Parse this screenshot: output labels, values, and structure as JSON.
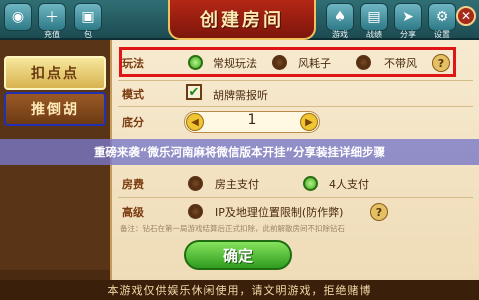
{
  "topbar": {
    "left_icons": [
      {
        "icon": "coin-icon",
        "label": ""
      },
      {
        "icon": "recharge-icon",
        "label": "充值"
      },
      {
        "icon": "gift-icon",
        "label": "包"
      }
    ],
    "right_icons": [
      {
        "icon": "game-icon",
        "label": "游戏"
      },
      {
        "icon": "record-icon",
        "label": "战绩"
      },
      {
        "icon": "share-icon",
        "label": "分享"
      },
      {
        "icon": "settings-icon",
        "label": "设置"
      }
    ],
    "title": "创建房间",
    "close_symbol": "✕"
  },
  "sidebar": {
    "tabs": [
      {
        "label": "扣点点",
        "active": true
      },
      {
        "label": "推倒胡",
        "active": false
      }
    ]
  },
  "form": {
    "play": {
      "label": "玩法",
      "options": [
        {
          "text": "常规玩法",
          "selected": true
        },
        {
          "text": "风耗子",
          "selected": false
        },
        {
          "text": "不带风",
          "selected": false
        }
      ],
      "help": "?"
    },
    "mode": {
      "label": "模式",
      "checkbox_text": "胡牌需报听",
      "checked": true,
      "check_symbol": "✔"
    },
    "score": {
      "label": "底分",
      "value": "1",
      "minus": "◀",
      "plus": "▶"
    },
    "fee": {
      "label": "房费",
      "options": [
        {
          "text": "房主支付",
          "selected": false
        },
        {
          "text": "4人支付",
          "selected": true
        }
      ]
    },
    "advanced": {
      "label": "高级",
      "option_text": "IP及地理位置限制(防作弊)",
      "selected": false,
      "help": "?"
    },
    "note": "备注：钻石在第一局游戏结算后正式扣除，此前解散房间不扣除钻石"
  },
  "overlay": {
    "headline": "重磅来袭“微乐河南麻将微信版本开挂”分享装挂详细步骤"
  },
  "confirm_label": "确定",
  "footer": "本游戏仅供娱乐休闲使用，请文明游戏，拒绝赌博"
}
